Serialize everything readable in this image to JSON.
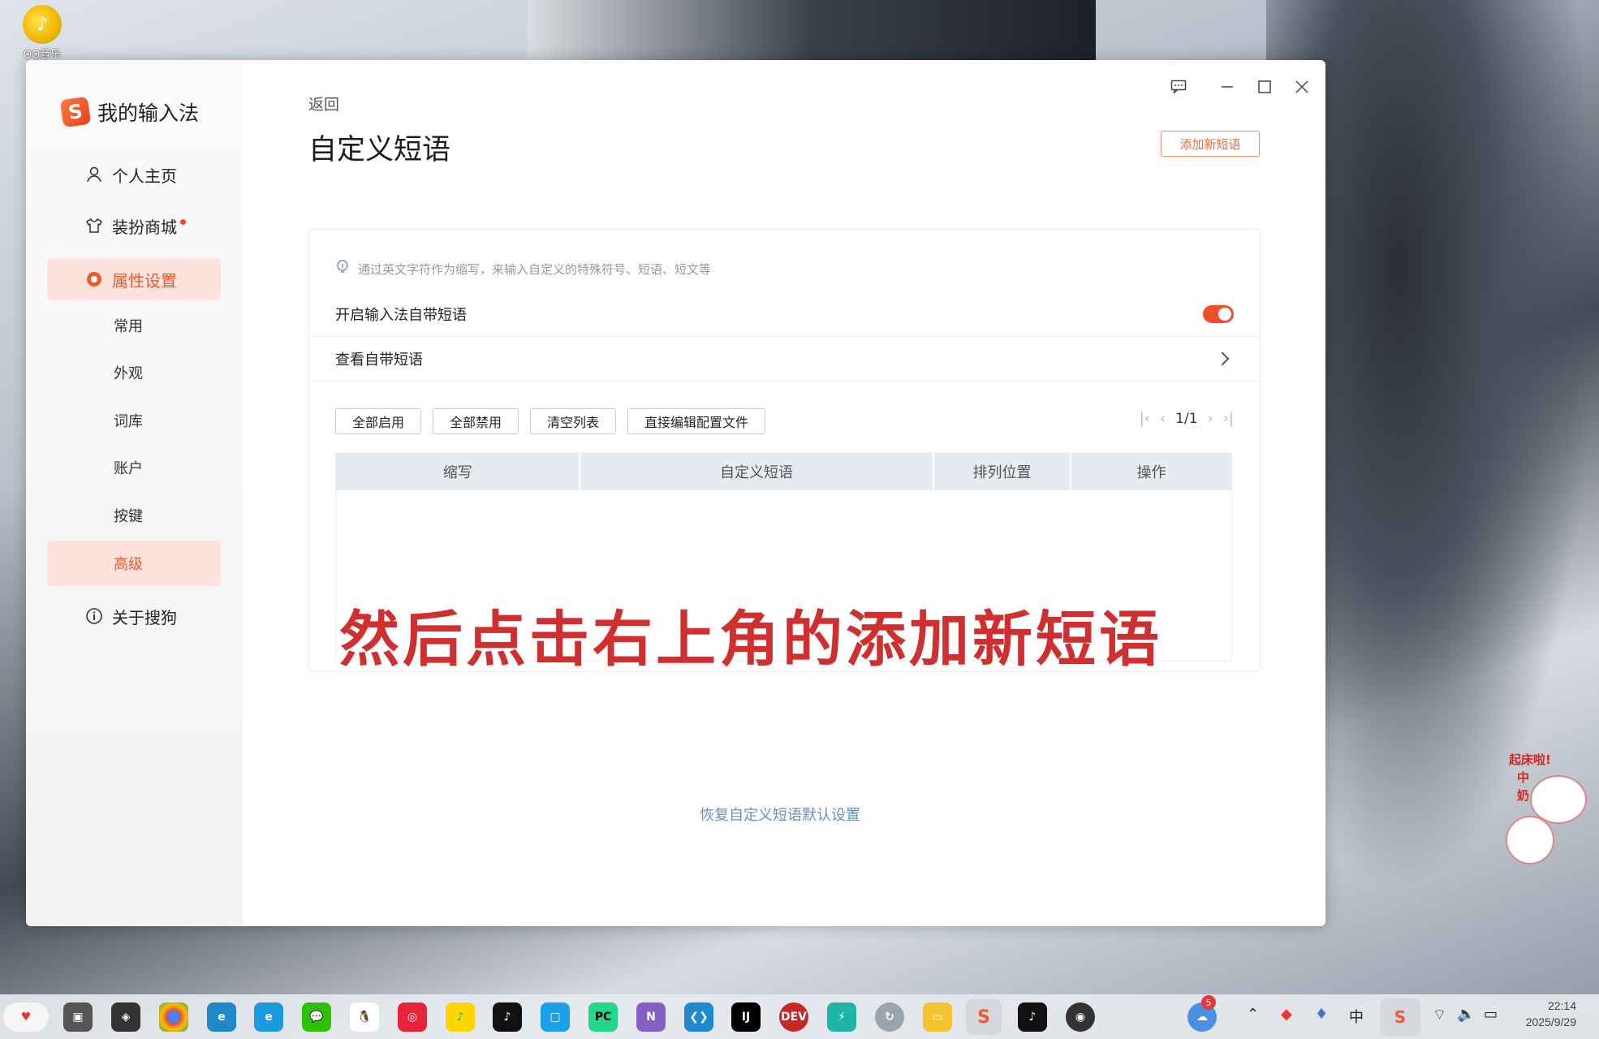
{
  "desktop": {
    "icon_label": "QQ音乐",
    "sticker_text": [
      "起床啦!",
      "中",
      "奶"
    ]
  },
  "sidebar": {
    "brand": "我的输入法",
    "nav": [
      {
        "label": "个人主页",
        "icon": "user-icon"
      },
      {
        "label": "装扮商城",
        "icon": "shirt-icon",
        "has_dot": true
      },
      {
        "label": "属性设置",
        "icon": "settings-icon",
        "active": true
      },
      {
        "label": "关于搜狗",
        "icon": "info-icon"
      }
    ],
    "sub_items": [
      "常用",
      "外观",
      "词库",
      "账户",
      "按键",
      "高级"
    ],
    "active_sub": "高级"
  },
  "header": {
    "back": "返回",
    "title": "自定义短语",
    "add_button": "添加新短语"
  },
  "panel": {
    "hint": "通过英文字符作为缩写，来输入自定义的特殊符号、短语、短文等",
    "enable_label": "开启输入法自带短语",
    "enable_on": true,
    "view_label": "查看自带短语",
    "buttons": [
      "全部启用",
      "全部禁用",
      "清空列表",
      "直接编辑配置文件"
    ],
    "page": "1/1",
    "columns": [
      "缩写",
      "自定义短语",
      "排列位置",
      "操作"
    ]
  },
  "overlay_caption": "然后点击右上角的添加新短语",
  "restore_link": "恢复自定义短语默认设置",
  "taskbar": {
    "tray_lang": "中",
    "notification_count": "5",
    "time": "22:14",
    "date": "2025/9/29"
  },
  "colors": {
    "accent": "#ef5a2d",
    "active_bg": "#fde3dc",
    "overlay_text": "#cf2f2f",
    "link": "#6b8fbd"
  }
}
